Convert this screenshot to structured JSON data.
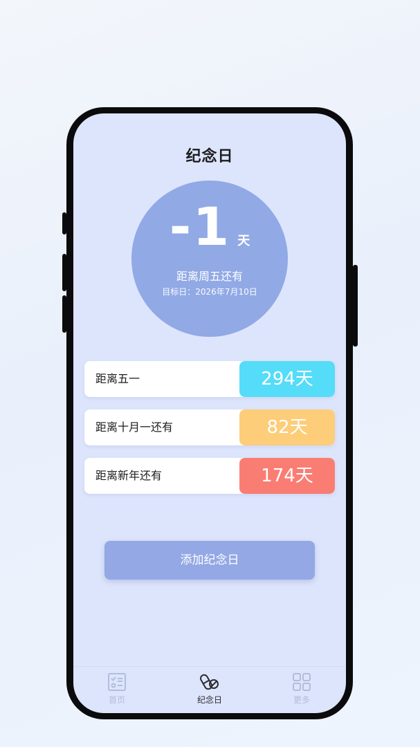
{
  "header": {
    "title": "纪念日"
  },
  "highlight": {
    "count": "-1",
    "unit": "天",
    "label": "距离周五还有",
    "target_date": "目标日：2026年7月10日"
  },
  "events": [
    {
      "name": "距离五一",
      "days": "294天",
      "color": "#55dcf8"
    },
    {
      "name": "距离十月一还有",
      "days": "82天",
      "color": "#fdcd79"
    },
    {
      "name": "距离新年还有",
      "days": "174天",
      "color": "#fa7d74"
    }
  ],
  "add_button": {
    "label": "添加纪念日"
  },
  "tabbar": {
    "tabs": [
      {
        "label": "首页",
        "icon": "checklist-icon",
        "active": false
      },
      {
        "label": "纪念日",
        "icon": "pills-icon",
        "active": true
      },
      {
        "label": "更多",
        "icon": "grid-icon",
        "active": false
      }
    ]
  },
  "colors": {
    "screen_bg": "#dde5fc",
    "accent": "#93a8e4",
    "tab_active": "#2b2b2e",
    "tab_inactive": "#b3bdd9"
  }
}
